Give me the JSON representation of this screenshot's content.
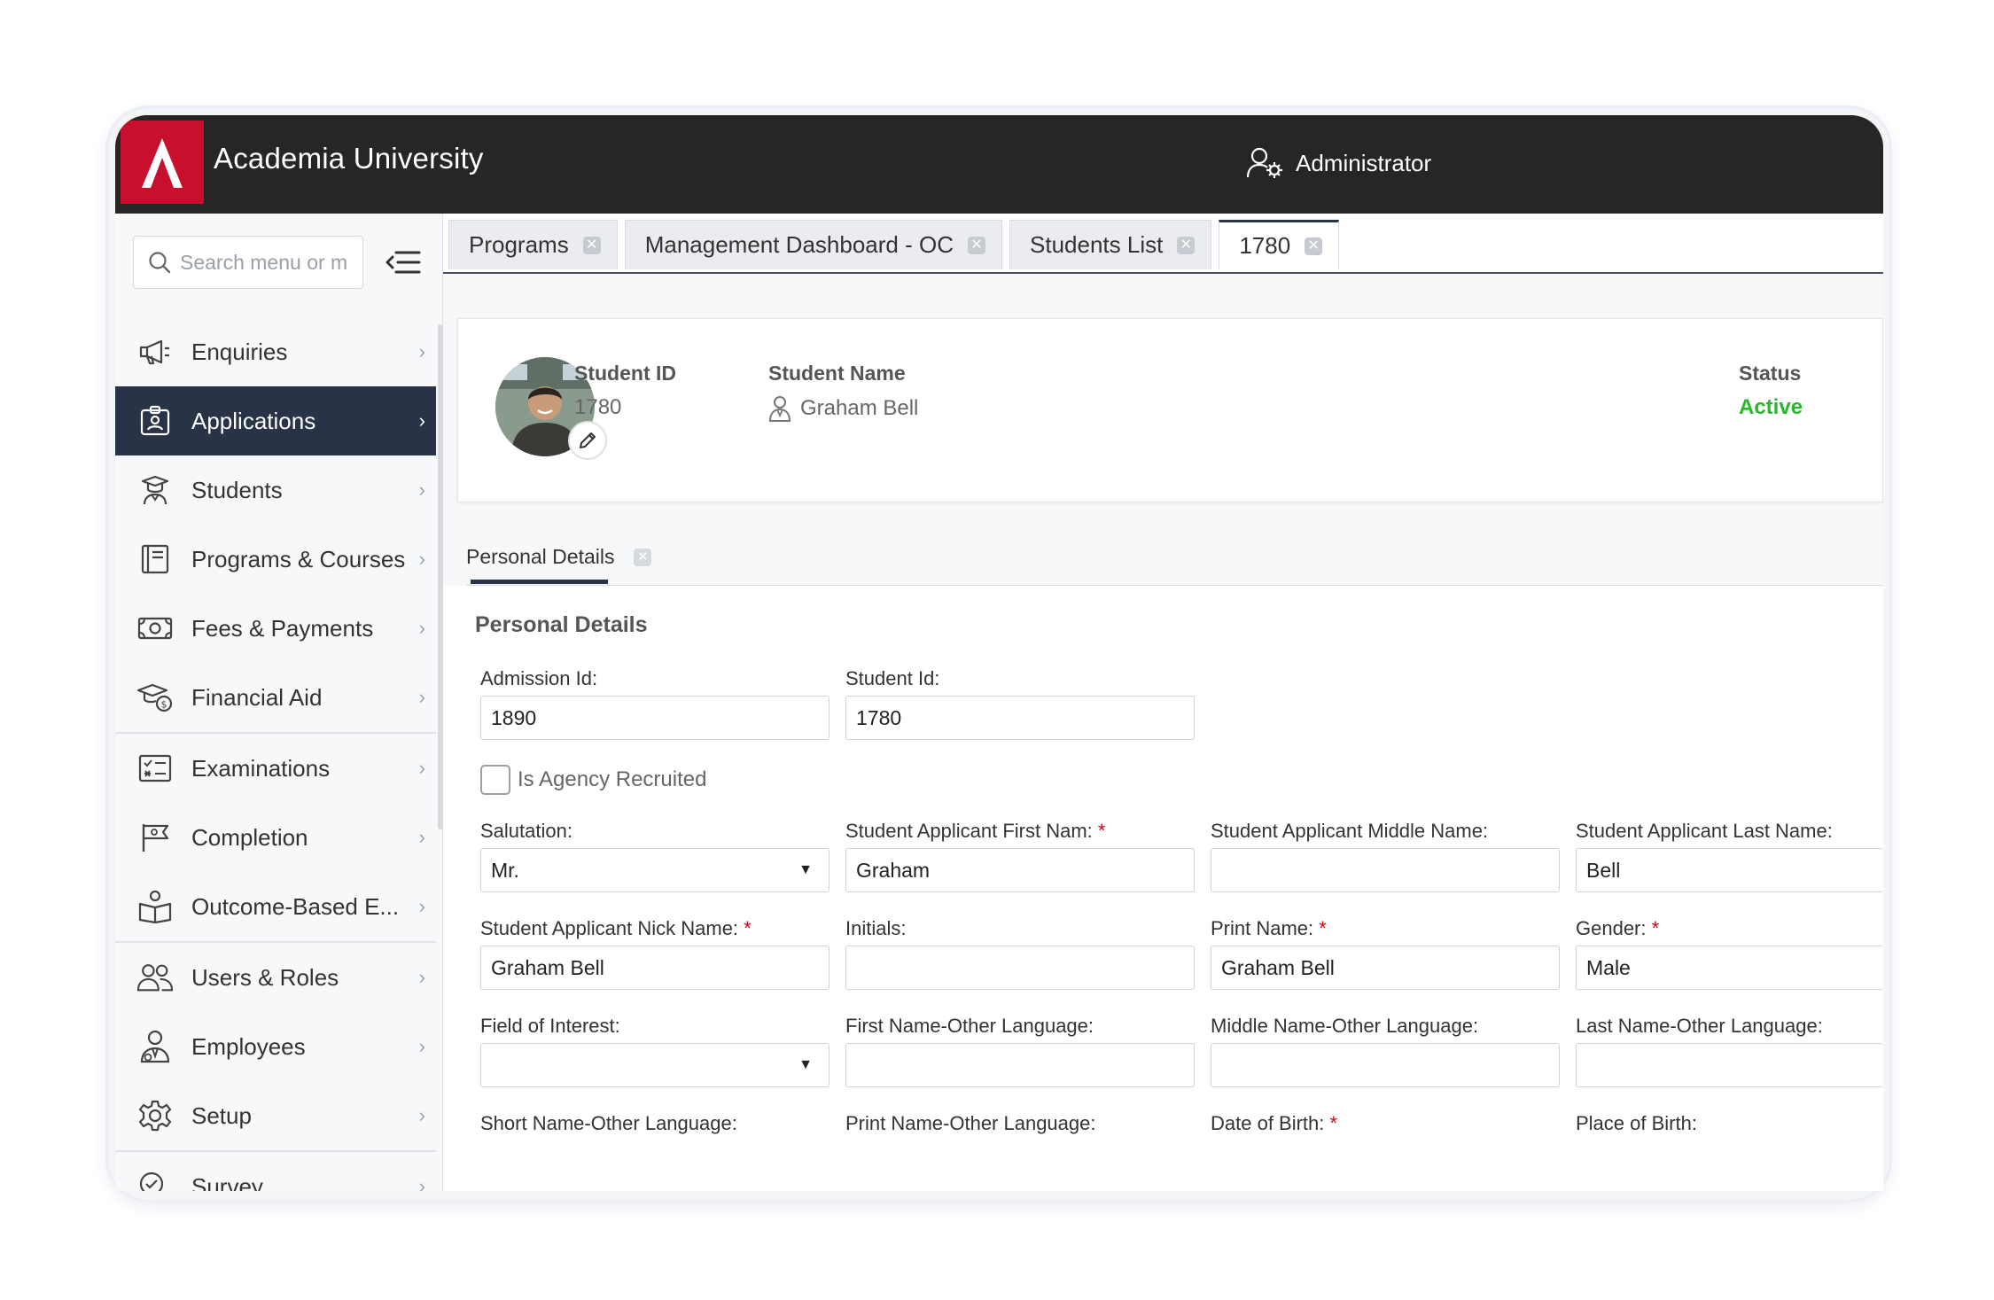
{
  "header": {
    "brand": "Academia University",
    "user_role": "Administrator"
  },
  "sidebar": {
    "search_placeholder": "Search menu or m",
    "items": [
      {
        "label": "Enquiries",
        "icon": "megaphone-icon"
      },
      {
        "label": "Applications",
        "icon": "id-badge-icon",
        "active": true
      },
      {
        "label": "Students",
        "icon": "graduate-icon"
      },
      {
        "label": "Programs & Courses",
        "icon": "book-icon"
      },
      {
        "label": "Fees & Payments",
        "icon": "money-icon"
      },
      {
        "label": "Financial Aid",
        "icon": "cap-coin-icon"
      },
      {
        "label": "Examinations",
        "icon": "checklist-icon"
      },
      {
        "label": "Completion",
        "icon": "flag-icon"
      },
      {
        "label": "Outcome-Based E...",
        "icon": "reader-icon"
      },
      {
        "label": "Users & Roles",
        "icon": "users-icon"
      },
      {
        "label": "Employees",
        "icon": "employee-icon"
      },
      {
        "label": "Setup",
        "icon": "gear-icon"
      },
      {
        "label": "Survey",
        "icon": "survey-icon"
      }
    ]
  },
  "tabs": [
    {
      "label": "Programs"
    },
    {
      "label": "Management Dashboard - OC"
    },
    {
      "label": "Students List"
    },
    {
      "label": "1780",
      "active": true
    }
  ],
  "student_card": {
    "id_label": "Student ID",
    "id_value": "1780",
    "name_label": "Student Name",
    "name_value": "Graham Bell",
    "status_label": "Status",
    "status_value": "Active",
    "status_color": "#28b828"
  },
  "subtab": {
    "label": "Personal Details"
  },
  "form": {
    "section_title": "Personal Details",
    "admission_id": {
      "label": "Admission Id:",
      "value": "1890"
    },
    "student_id": {
      "label": "Student Id:",
      "value": "1780"
    },
    "agency": {
      "label": "Is Agency Recruited",
      "checked": false
    },
    "salutation": {
      "label": "Salutation:",
      "value": "Mr."
    },
    "first_name": {
      "label": "Student Applicant First Nam:",
      "value": "Graham",
      "required": true
    },
    "middle_name": {
      "label": "Student Applicant Middle Name:",
      "value": ""
    },
    "last_name": {
      "label": "Student Applicant Last Name:",
      "value": "Bell"
    },
    "nick_name": {
      "label": "Student Applicant Nick Name:",
      "value": "Graham Bell",
      "required": true
    },
    "initials": {
      "label": "Initials:",
      "value": ""
    },
    "print_name": {
      "label": "Print Name:",
      "value": "Graham Bell",
      "required": true
    },
    "gender": {
      "label": "Gender:",
      "value": "Male",
      "required": true
    },
    "field_of_interest": {
      "label": "Field of Interest:",
      "value": ""
    },
    "first_name_other": {
      "label": "First Name-Other Language:",
      "value": ""
    },
    "middle_name_other": {
      "label": "Middle Name-Other Language:",
      "value": ""
    },
    "last_name_other": {
      "label": "Last Name-Other Language:",
      "value": ""
    },
    "short_name_other": {
      "label": "Short Name-Other Language:"
    },
    "print_name_other": {
      "label": "Print Name-Other Language:"
    },
    "dob": {
      "label": "Date of Birth:",
      "required": true
    },
    "place_of_birth": {
      "label": "Place of Birth:"
    },
    "required_mark": "*"
  },
  "colors": {
    "topbar": "#262626",
    "logo": "#c8102e",
    "active_nav": "#283347"
  }
}
